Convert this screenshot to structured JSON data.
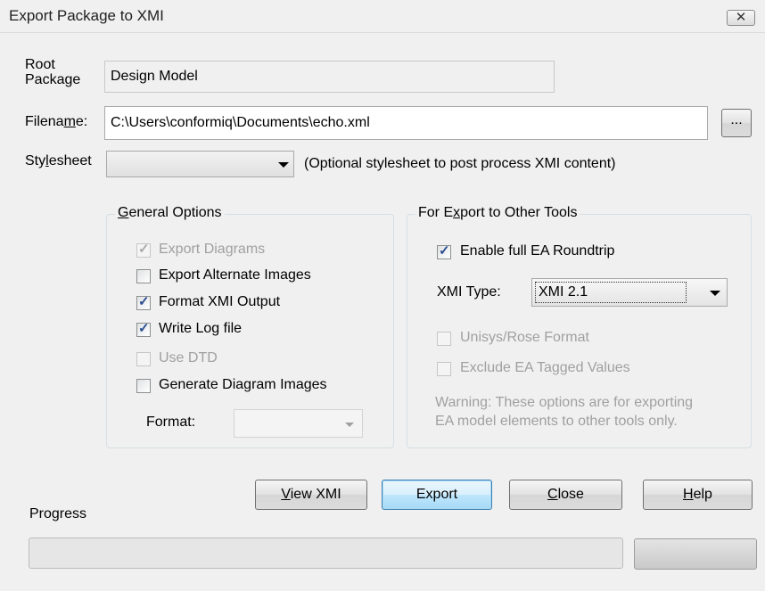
{
  "window": {
    "title": "Export Package to XMI",
    "close_glyph": "✕"
  },
  "root_package": {
    "label_line1": "Root",
    "label_line2": "Package",
    "value": "Design Model"
  },
  "filename": {
    "label_pre": "Filena",
    "label_u": "m",
    "label_post": "e:",
    "value": "C:\\Users\\conformiq\\Documents\\echo.xml",
    "browse_label": "..."
  },
  "stylesheet": {
    "label_pre": "Sty",
    "label_u": "l",
    "label_post": "esheet",
    "value": "",
    "hint": "(Optional stylesheet to post process XMI content)"
  },
  "general_options": {
    "title_u": "G",
    "title_rest": "eneral Options",
    "items": [
      {
        "label": "Export Diagrams",
        "checked": true,
        "disabled": true
      },
      {
        "label": "Export Alternate Images",
        "checked": false,
        "disabled": false
      },
      {
        "label": "Format XMI Output",
        "checked": true,
        "disabled": false
      },
      {
        "label": "Write Log file",
        "checked": true,
        "disabled": false
      },
      {
        "label": "Use DTD",
        "checked": false,
        "disabled": true
      },
      {
        "label": "Generate Diagram Images",
        "checked": false,
        "disabled": false
      }
    ],
    "format_label": "Format:",
    "format_value": ""
  },
  "other_tools": {
    "title_pre": "For E",
    "title_u": "x",
    "title_post": "port to Other Tools",
    "roundtrip": {
      "label": "Enable full EA Roundtrip",
      "checked": true
    },
    "xmi_type_label": "XMI Type:",
    "xmi_type_value": "XMI 2.1",
    "unisys": {
      "label": "Unisys/Rose Format",
      "checked": false,
      "disabled": true
    },
    "exclude": {
      "label": "Exclude EA Tagged Values",
      "checked": false,
      "disabled": true
    },
    "warning_line1": "Warning: These options are for exporting",
    "warning_line2": "EA model elements to other tools only."
  },
  "buttons": {
    "view_u": "V",
    "view_rest": "iew XMI",
    "export": "Export",
    "close_u": "C",
    "close_rest": "lose",
    "help_u": "H",
    "help_rest": "elp"
  },
  "progress": {
    "label": "Progress",
    "value": 0
  }
}
